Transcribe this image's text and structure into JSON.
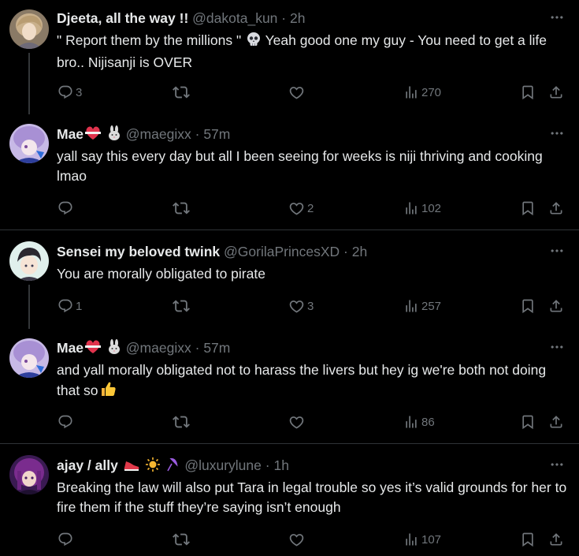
{
  "tweets": [
    {
      "name": "Djeeta, all the way !!",
      "handle": "@dakota_kun",
      "separator": "·",
      "time": "2h",
      "text_1": "\" Report them by the millions \" ",
      "text_2": " Yeah good one my guy - You need to get a life bro.. Nijisanji is OVER",
      "inline_emoji": "skull-icon",
      "replies": "3",
      "reposts": "",
      "likes": "",
      "views": "270",
      "avatar_colors": [
        "#c7b08e",
        "#7d6a56"
      ]
    },
    {
      "name": "Mae",
      "name_emojis": [
        "heart-ribbon-icon",
        "rabbit-icon"
      ],
      "handle": "@maegixx",
      "separator": "·",
      "time": "57m",
      "text": "yall say this every day but all I been seeing for weeks is niji thriving and cooking lmao",
      "replies": "",
      "reposts": "",
      "likes": "2",
      "views": "102",
      "avatar_colors": [
        "#b29ad6",
        "#2f3a8a"
      ]
    },
    {
      "name": "Sensei my beloved twink",
      "handle": "@GorilaPrincesXD",
      "separator": "·",
      "time": "2h",
      "text": "You are morally obligated to pirate",
      "replies": "1",
      "reposts": "",
      "likes": "3",
      "views": "257",
      "avatar_colors": [
        "#d8ece6",
        "#2c2a30"
      ]
    },
    {
      "name": "Mae",
      "name_emojis": [
        "heart-ribbon-icon",
        "rabbit-icon"
      ],
      "handle": "@maegixx",
      "separator": "·",
      "time": "57m",
      "text": "and yall morally obligated not to harass the livers but hey ig we're both not doing that so",
      "trailing_emoji": "thumbs-up-icon",
      "replies": "",
      "reposts": "",
      "likes": "",
      "views": "86",
      "avatar_colors": [
        "#b29ad6",
        "#2f3a8a"
      ]
    },
    {
      "name": "ajay / ally",
      "name_emojis": [
        "sneaker-icon",
        "sun-icon",
        "umbrella-icon"
      ],
      "handle": "@luxurylune",
      "separator": "·",
      "time": "1h",
      "text": "Breaking the law will also put Tara in legal trouble so yes it’s valid grounds for her to fire them if the stuff they’re saying isn’t enough",
      "replies": "",
      "reposts": "",
      "likes": "",
      "views": "107",
      "avatar_colors": [
        "#7a2c8e",
        "#1e1030"
      ]
    }
  ],
  "colors": {
    "background": "#000000",
    "text": "#e7e9ea",
    "secondary": "#71767b",
    "divider": "#2f3336"
  }
}
